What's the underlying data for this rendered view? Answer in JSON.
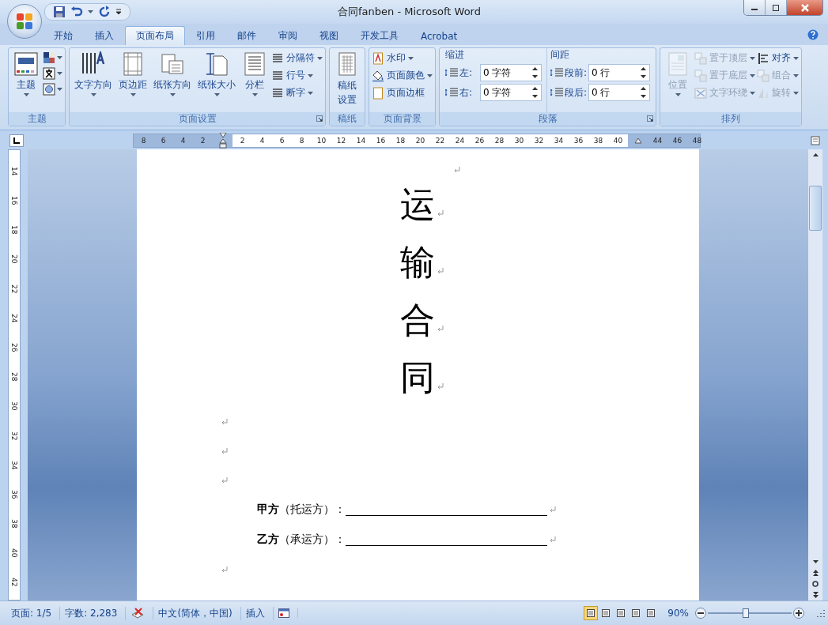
{
  "window": {
    "title": "合同fanben - Microsoft Word"
  },
  "tabs": [
    {
      "label": "开始",
      "selected": false
    },
    {
      "label": "插入",
      "selected": false
    },
    {
      "label": "页面布局",
      "selected": true
    },
    {
      "label": "引用",
      "selected": false
    },
    {
      "label": "邮件",
      "selected": false
    },
    {
      "label": "审阅",
      "selected": false
    },
    {
      "label": "视图",
      "selected": false
    },
    {
      "label": "开发工具",
      "selected": false
    },
    {
      "label": "Acrobat",
      "selected": false
    }
  ],
  "ribbon": {
    "groups": [
      {
        "kind": "theme",
        "label": "主题",
        "launcher": false,
        "items": [
          {
            "kind": "large",
            "label": "主题",
            "dropdown": true,
            "disabled": false
          },
          {
            "kind": "icon_stack",
            "buttons": [
              {
                "dropdown": true,
                "disabled": false
              },
              {
                "dropdown": true,
                "disabled": false
              },
              {
                "dropdown": true,
                "disabled": false
              }
            ]
          }
        ]
      },
      {
        "kind": "page_setup",
        "label": "页面设置",
        "launcher": true,
        "items": [
          {
            "kind": "large",
            "label": "文字方向",
            "dropdown": true,
            "disabled": false
          },
          {
            "kind": "large",
            "label": "页边距",
            "dropdown": true,
            "disabled": false
          },
          {
            "kind": "large",
            "label": "纸张方向",
            "dropdown": true,
            "disabled": false
          },
          {
            "kind": "large",
            "label": "纸张大小",
            "dropdown": true,
            "disabled": false
          },
          {
            "kind": "large",
            "label": "分栏",
            "dropdown": true,
            "disabled": false
          },
          {
            "kind": "small_stack",
            "buttons": [
              {
                "label": "分隔符",
                "dropdown": true,
                "disabled": false
              },
              {
                "label": "行号",
                "dropdown": true,
                "disabled": false
              },
              {
                "label": "断字",
                "dropdown": true,
                "disabled": false
              }
            ]
          }
        ]
      },
      {
        "kind": "paper",
        "label": "稿纸",
        "launcher": false,
        "items": [
          {
            "kind": "large",
            "label": "稿纸设置",
            "dropdown": false,
            "disabled": false
          }
        ]
      },
      {
        "kind": "background",
        "label": "页面背景",
        "launcher": false,
        "items": [
          {
            "kind": "small_stack",
            "buttons": [
              {
                "label": "水印",
                "dropdown": true,
                "disabled": false
              },
              {
                "label": "页面颜色",
                "dropdown": true,
                "disabled": false
              },
              {
                "label": "页面边框",
                "dropdown": false,
                "disabled": false
              }
            ]
          }
        ]
      },
      {
        "kind": "paragraph",
        "label": "段落",
        "launcher": true,
        "items": [
          {
            "kind": "spin_section",
            "label": "缩进",
            "fields": [
              {
                "label": "左:",
                "value": "0 字符"
              },
              {
                "label": "右:",
                "value": "0 字符"
              }
            ]
          },
          {
            "kind": "spin_section",
            "label": "间距",
            "fields": [
              {
                "label": "段前:",
                "value": "0 行"
              },
              {
                "label": "段后:",
                "value": "0 行"
              }
            ]
          }
        ]
      },
      {
        "kind": "arrange",
        "label": "排列",
        "launcher": false,
        "items": [
          {
            "kind": "large",
            "label": "位置",
            "dropdown": true,
            "disabled": true
          },
          {
            "kind": "small_stack",
            "buttons": [
              {
                "label": "置于顶层",
                "dropdown": true,
                "disabled": true
              },
              {
                "label": "置于底层",
                "dropdown": true,
                "disabled": true
              },
              {
                "label": "文字环绕",
                "dropdown": true,
                "disabled": true
              }
            ]
          },
          {
            "kind": "small_stack",
            "buttons": [
              {
                "label": "对齐",
                "dropdown": true,
                "disabled": false
              },
              {
                "label": "组合",
                "dropdown": true,
                "disabled": true
              },
              {
                "label": "旋转",
                "dropdown": true,
                "disabled": true
              }
            ]
          }
        ]
      }
    ]
  },
  "ruler": {
    "left_labels": [
      "8",
      "6",
      "4",
      "2"
    ],
    "body_labels": [
      "2",
      "4",
      "6",
      "8",
      "10",
      "12",
      "14",
      "16",
      "18",
      "20",
      "22",
      "24",
      "26",
      "28",
      "30",
      "32",
      "34",
      "36",
      "38",
      "40"
    ],
    "right_labels": [
      "44",
      "46",
      "48"
    ],
    "vertical_labels": [
      "14",
      "16",
      "18",
      "20",
      "22",
      "24",
      "26",
      "28",
      "30",
      "32",
      "34",
      "36",
      "38",
      "40",
      "42"
    ]
  },
  "document": {
    "paragraphs": [
      {
        "kind": "clipped"
      },
      {
        "kind": "title",
        "text": "运"
      },
      {
        "kind": "title",
        "text": "输"
      },
      {
        "kind": "title",
        "text": "合"
      },
      {
        "kind": "title",
        "text": "同"
      },
      {
        "kind": "empty"
      },
      {
        "kind": "empty"
      },
      {
        "kind": "empty"
      },
      {
        "kind": "party",
        "text": "**甲方**（托运方）："
      },
      {
        "kind": "party",
        "text": "**乙方**（承运方）："
      },
      {
        "kind": "empty"
      }
    ]
  },
  "status_bar": {
    "items": [
      {
        "kind": "text",
        "label": "页面: 1/5"
      },
      {
        "kind": "text",
        "label": "字数: 2,283"
      },
      {
        "kind": "proofing"
      },
      {
        "kind": "text",
        "label": "中文(简体，中国)"
      },
      {
        "kind": "text",
        "label": "插入"
      },
      {
        "kind": "macro"
      }
    ],
    "views": [
      {
        "selected": true
      },
      {
        "selected": false
      },
      {
        "selected": false
      },
      {
        "selected": false
      },
      {
        "selected": false
      }
    ],
    "zoom": {
      "label": "90%",
      "level": 0.45
    }
  }
}
